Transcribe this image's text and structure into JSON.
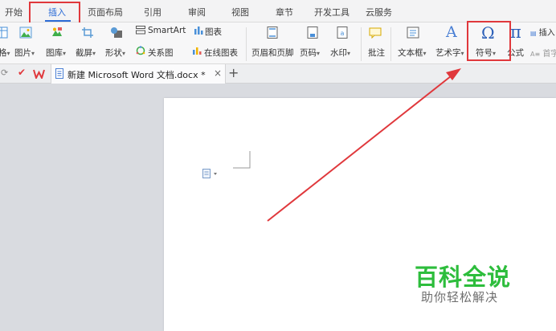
{
  "menu_tabs": [
    "开始",
    "插入",
    "页面布局",
    "引用",
    "审阅",
    "视图",
    "章节",
    "开发工具",
    "云服务"
  ],
  "active_tab": "插入",
  "ribbon": {
    "table_partial": "格",
    "picture": "图片",
    "gallery": "图库",
    "screenshot": "截屏",
    "shapes": "形状",
    "smartart": "SmartArt",
    "chart": "图表",
    "relation_chart": "关系图",
    "online_chart": "在线图表",
    "header_footer": "页眉和页脚",
    "page_number": "页码",
    "watermark": "水印",
    "comment": "批注",
    "textbox": "文本框",
    "wordart": "艺术字",
    "symbol": "符号",
    "formula": "公式",
    "insert_partial": "插入",
    "initial_partial": "首字"
  },
  "symbol_glyph": "Ω",
  "formula_glyph": "π",
  "wordart_glyph": "A",
  "document_tab": {
    "title": "新建 Microsoft Word 文档.docx *",
    "close": "×",
    "new_tab": "+"
  },
  "watermark": {
    "title": "百科全说",
    "subtitle": "助你轻松解决"
  },
  "colors": {
    "accent": "#2b6bd6",
    "highlight_red": "#e0383c",
    "watermark_green": "#2dbd3c"
  },
  "icons": [
    "table-icon",
    "picture-icon",
    "gallery-icon",
    "screenshot-icon",
    "shapes-icon",
    "smartart-icon",
    "chart-icon",
    "relation-chart-icon",
    "online-chart-icon",
    "header-footer-icon",
    "page-number-icon",
    "watermark-icon",
    "comment-icon",
    "textbox-icon",
    "wordart-icon",
    "symbol-icon",
    "formula-icon",
    "wps-logo-icon",
    "doc-file-icon",
    "paste-options-icon"
  ]
}
